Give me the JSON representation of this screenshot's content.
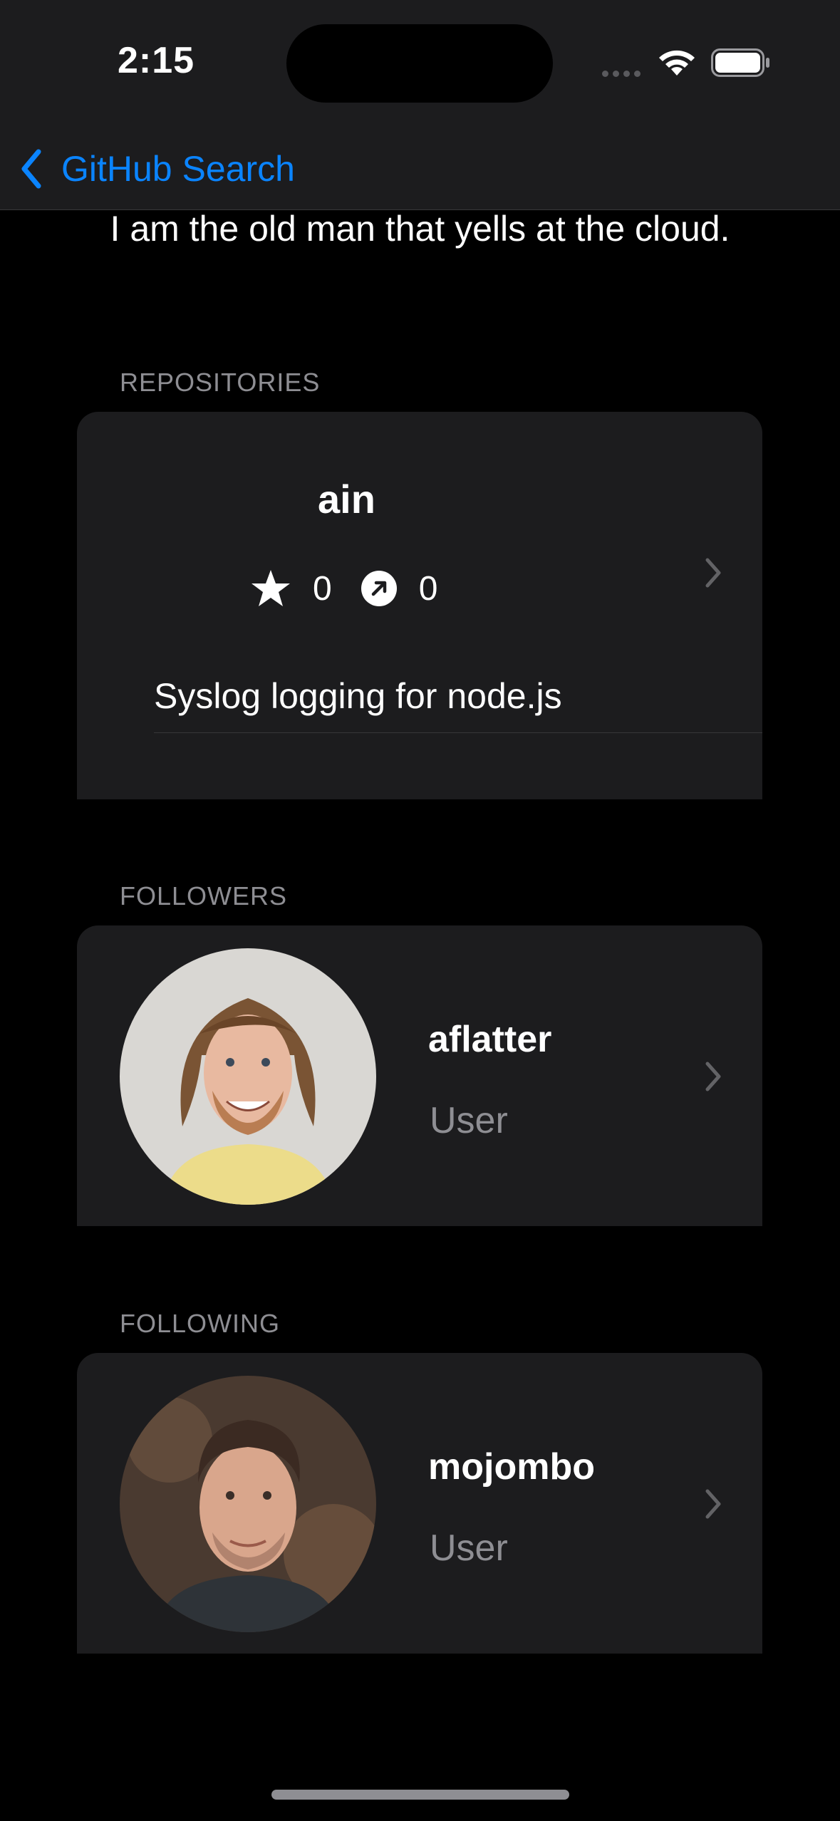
{
  "status_bar": {
    "time": "2:15"
  },
  "nav": {
    "back_label": "GitHub Search"
  },
  "profile": {
    "bio": "I am the old man that yells at the cloud."
  },
  "repositories": {
    "header": "REPOSITORIES",
    "items": [
      {
        "name": "ain",
        "stars": "0",
        "forks": "0",
        "description": "Syslog logging for node.js"
      }
    ]
  },
  "followers": {
    "header": "FOLLOWERS",
    "items": [
      {
        "login": "aflatter",
        "type": "User"
      }
    ]
  },
  "following": {
    "header": "FOLLOWING",
    "items": [
      {
        "login": "mojombo",
        "type": "User"
      }
    ]
  },
  "colors": {
    "accent": "#0a84ff",
    "card_bg": "#1c1c1e",
    "secondary_text": "#8e8e93"
  }
}
